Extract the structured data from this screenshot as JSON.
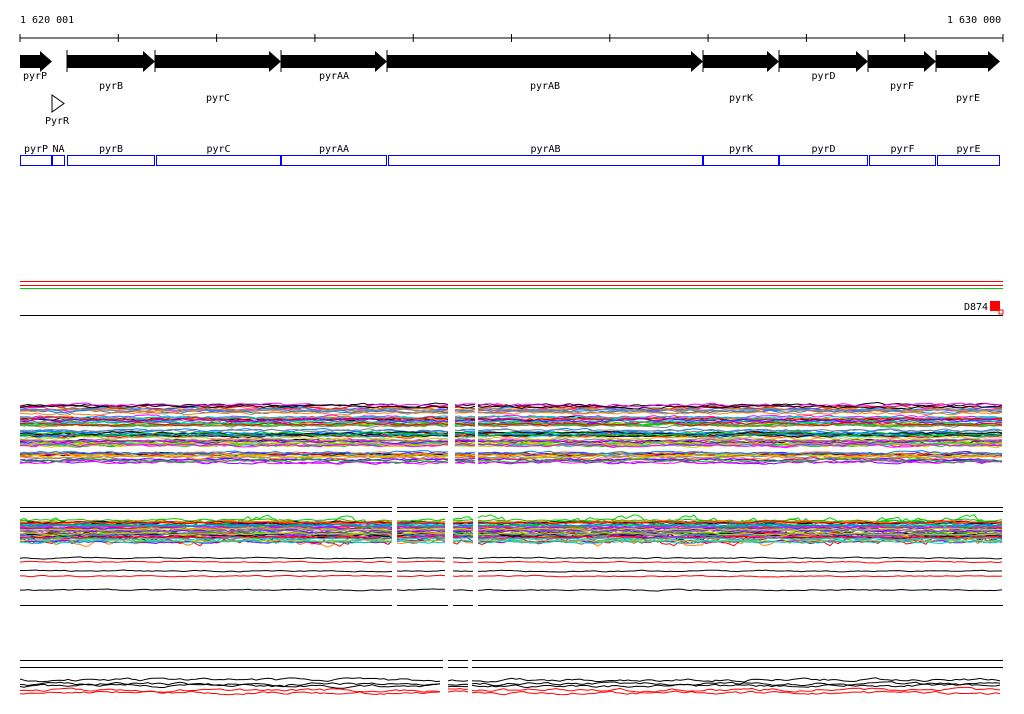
{
  "scale": {
    "start_label": "1 620 001",
    "end_label": "1 630 000"
  },
  "genes": [
    {
      "name": "pyrP",
      "row": 0
    },
    {
      "name": "pyrB",
      "row": 1
    },
    {
      "name": "pyrC",
      "row": 2
    },
    {
      "name": "pyrAA",
      "row": 0
    },
    {
      "name": "pyrAB",
      "row": 1
    },
    {
      "name": "pyrK",
      "row": 2
    },
    {
      "name": "pyrD",
      "row": 0
    },
    {
      "name": "pyrF",
      "row": 1
    },
    {
      "name": "pyrE",
      "row": 2
    }
  ],
  "regulator": {
    "name": "PyrR"
  },
  "transcripts": [
    "pyrP",
    "NA",
    "pyrB",
    "pyrC",
    "pyrAA",
    "pyrAB",
    "pyrK",
    "pyrD",
    "pyrF",
    "pyrE"
  ],
  "track_label": "D874",
  "colors": {
    "gene": "#000000",
    "transcript": "#0000ff",
    "marker": "#ff0000",
    "red_line": "#ff0000",
    "green_line": "#00cc00",
    "palette": [
      "#000000",
      "#ff00ff",
      "#00cc00",
      "#0080ff",
      "#ff8000",
      "#ff0000",
      "#00cccc",
      "#8000ff",
      "#808080",
      "#cccc00"
    ]
  }
}
